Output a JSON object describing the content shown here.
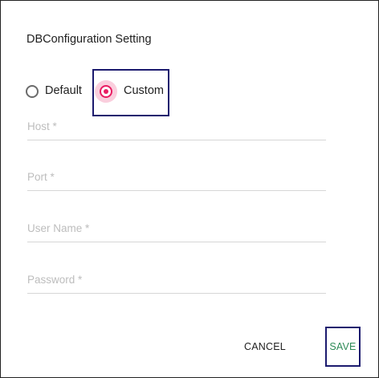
{
  "dialog": {
    "title": "DBConfiguration Setting"
  },
  "radio": {
    "options": [
      {
        "label": "Default",
        "selected": false
      },
      {
        "label": "Custom",
        "selected": true
      }
    ],
    "accent_color": "#e91e63"
  },
  "fields": {
    "host": {
      "label": "Host",
      "required_mark": "*",
      "label_full": "Host *",
      "value": ""
    },
    "port": {
      "label": "Port",
      "required_mark": "*",
      "label_full": "Port *",
      "value": ""
    },
    "user_name": {
      "label": "User Name",
      "required_mark": "*",
      "label_full": "User Name *",
      "value": ""
    },
    "password": {
      "label": "Password",
      "required_mark": "*",
      "label_full": "Password *",
      "value": ""
    }
  },
  "actions": {
    "cancel_label": "CANCEL",
    "save_label": "SAVE",
    "save_color": "#2e8b57"
  },
  "highlight_color": "#1b1a6e"
}
